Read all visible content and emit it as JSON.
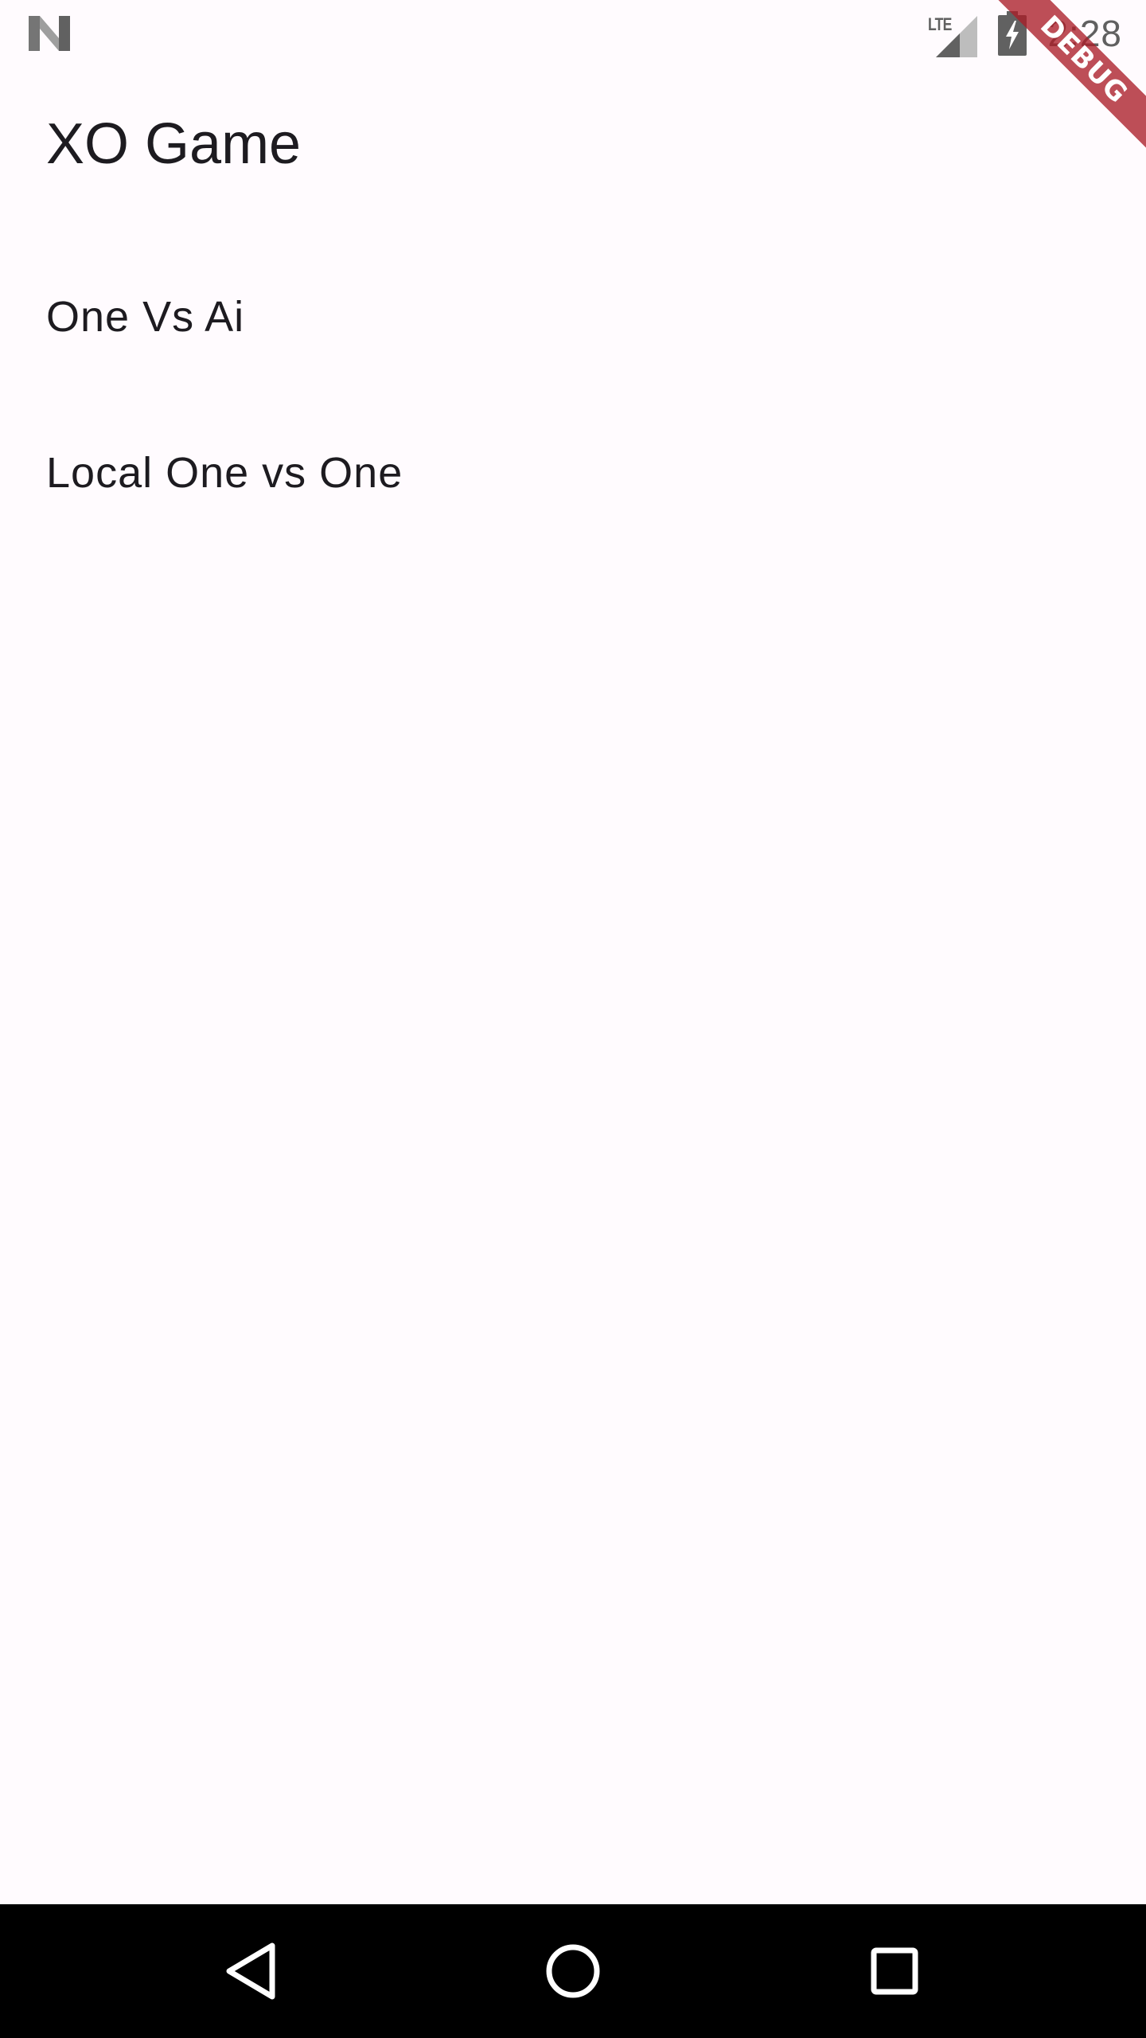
{
  "status_bar": {
    "left_icon": "n-logo-icon",
    "network_label": "LTE",
    "signal_icon": "cell-signal-icon",
    "battery_icon": "battery-charging-icon",
    "time": "2:28"
  },
  "debug_banner": {
    "label": "DEBUG",
    "color": "#b71c1c"
  },
  "app_bar": {
    "title": "XO Game"
  },
  "menu": {
    "items": [
      {
        "label": "One Vs Ai"
      },
      {
        "label": "Local One vs One"
      }
    ]
  },
  "nav_bar": {
    "buttons": [
      "back-icon",
      "home-icon",
      "recents-icon"
    ]
  },
  "colors": {
    "background": "#fffbfe",
    "text": "#1d1b20",
    "status_icons": "#606060",
    "nav_bar": "#000000"
  }
}
